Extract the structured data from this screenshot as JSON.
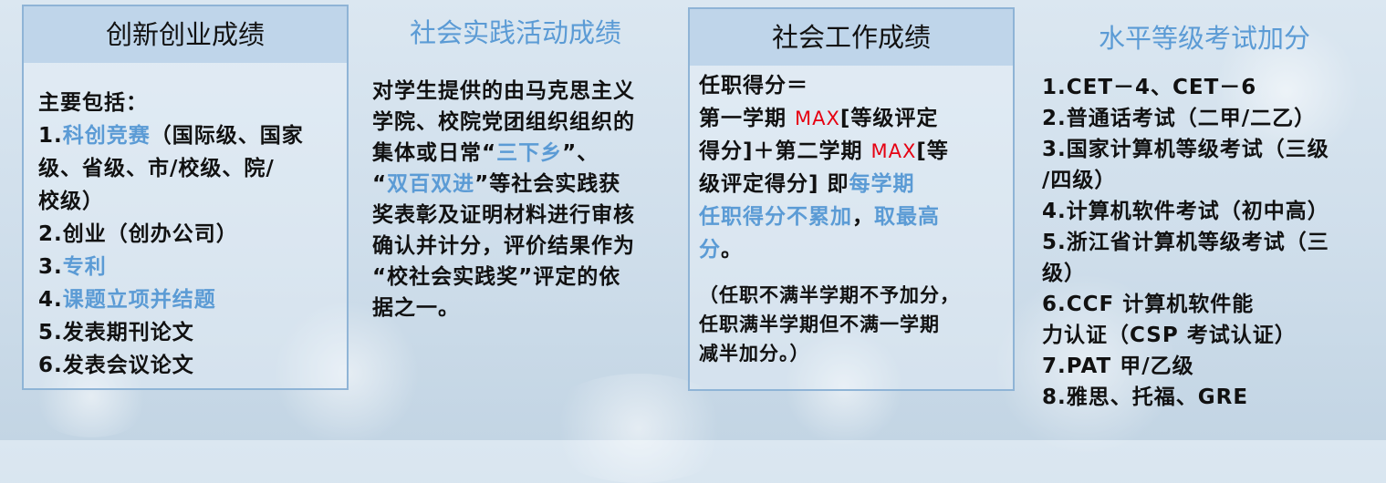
{
  "decor": {
    "bubbles": 6
  },
  "panels": [
    {
      "title": "创新创业成绩",
      "lines": [
        [
          {
            "t": "主要包括："
          }
        ],
        [
          {
            "t": "1."
          },
          {
            "t": "科创竞赛",
            "blue": true
          },
          {
            "t": "（国际级、国家"
          }
        ],
        [
          {
            "t": "级、省级、市/校级、院/"
          }
        ],
        [
          {
            "t": "校级）"
          }
        ],
        [
          {
            "t": "2.创业（创办公司）"
          }
        ],
        [
          {
            "t": "3."
          },
          {
            "t": "专利",
            "blue": true
          }
        ],
        [
          {
            "t": "4."
          },
          {
            "t": "课题立项并结题",
            "blue": true
          }
        ],
        [
          {
            "t": "5.发表期刊论文"
          }
        ],
        [
          {
            "t": "6.发表会议论文"
          }
        ]
      ]
    },
    {
      "title": "社会实践活动成绩",
      "lines": [
        [
          {
            "t": "对学生提供的由马克思主义"
          }
        ],
        [
          {
            "t": "学院、校院党团组织组织的"
          }
        ],
        [
          {
            "t": "集体或日常“"
          },
          {
            "t": "三下乡",
            "blue": true
          },
          {
            "t": "”、"
          }
        ],
        [
          {
            "t": "“"
          },
          {
            "t": "双百双进",
            "blue": true
          },
          {
            "t": "”等社会实践获"
          }
        ],
        [
          {
            "t": "奖表彰及证明材料进行审核"
          }
        ],
        [
          {
            "t": "确认并计分，评价结果作为"
          }
        ],
        [
          {
            "t": "“校社会实践奖”评定的依"
          }
        ],
        [
          {
            "t": "据之一。"
          }
        ]
      ]
    },
    {
      "title": "社会工作成绩",
      "lines": [
        [
          {
            "t": "任职得分＝"
          }
        ],
        [
          {
            "t": "第一学期 "
          },
          {
            "t": "MAX",
            "red": true
          },
          {
            "t": "[等级评定"
          }
        ],
        [
          {
            "t": "得分]＋第二学期 "
          },
          {
            "t": "MAX",
            "red": true
          },
          {
            "t": "[等"
          }
        ],
        [
          {
            "t": "级评定得分]  即"
          },
          {
            "t": "每学期",
            "blue": true
          }
        ],
        [
          {
            "t": "任职得分不累加",
            "blue": true
          },
          {
            "t": "，"
          },
          {
            "t": "取最高",
            "blue": true
          }
        ],
        [
          {
            "t": "分",
            "blue": true
          },
          {
            "t": "。"
          }
        ]
      ],
      "note_lines": [
        "（任职不满半学期不予加分，",
        "任职满半学期但不满一学期",
        "减半加分。）"
      ]
    },
    {
      "title": "水平等级考试加分",
      "lines": [
        [
          {
            "t": "1.CET－4、CET－6"
          }
        ],
        [
          {
            "t": "2.普通话考试（二甲/二乙）"
          }
        ],
        [
          {
            "t": "3.国家计算机等级考试（三级"
          }
        ],
        [
          {
            "t": "/四级）"
          }
        ],
        [
          {
            "t": "4.计算机软件考试（初中高）"
          }
        ],
        [
          {
            "t": "5.浙江省计算机等级考试（三"
          }
        ],
        [
          {
            "t": "级）"
          }
        ],
        [
          {
            "t": "6.CCF 计算机软件能"
          }
        ],
        [
          {
            "t": "力认证（CSP 考试认证）"
          }
        ],
        [
          {
            "t": "7.PAT 甲/乙级"
          }
        ],
        [
          {
            "t": "8.雅思、托福、GRE"
          }
        ]
      ]
    }
  ]
}
